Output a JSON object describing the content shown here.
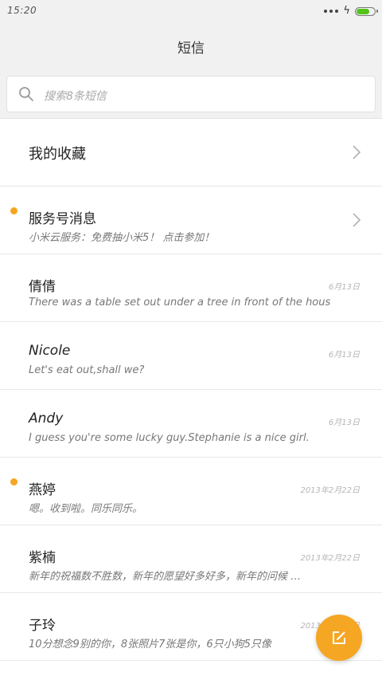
{
  "status_bar": {
    "time": "15:20",
    "battery_level": 0.78,
    "battery_color": "#53c41a",
    "icons": [
      "signal-dots-icon",
      "charging-bolt-icon",
      "battery-icon"
    ]
  },
  "header": {
    "title": "短信"
  },
  "search": {
    "placeholder": "搜索8条短信",
    "icon": "search-icon"
  },
  "favorites": {
    "label": "我的收藏",
    "icon": "chevron-right-icon"
  },
  "conversations": [
    {
      "sender": "服务号消息",
      "preview": "小米云服务：免费抽小米5！ 点击参加！",
      "date": "",
      "unread": true,
      "has_chevron": true
    },
    {
      "sender": "倩倩",
      "preview": "There was a table set out under a tree in front of the hous",
      "date": "6月13日",
      "unread": false,
      "has_chevron": false
    },
    {
      "sender": "Nicole",
      "preview": "Let's eat out,shall we?",
      "date": "6月13日",
      "unread": false,
      "has_chevron": false
    },
    {
      "sender": "Andy",
      "preview": "I guess you're some lucky guy.Stephanie is a nice girl.",
      "date": "6月13日",
      "unread": false,
      "has_chevron": false
    },
    {
      "sender": "燕婷",
      "preview": "嗯。收到啦。同乐同乐。",
      "date": "2013年2月22日",
      "unread": true,
      "has_chevron": false
    },
    {
      "sender": "紫楠",
      "preview": "新年的祝福数不胜数，新年的愿望好多好多，新年的问候 …",
      "date": "2013年2月22日",
      "unread": false,
      "has_chevron": false
    },
    {
      "sender": "子玲",
      "preview": "10分想念9别的你，8张照片7张是你，6只小狗5只像",
      "date": "2013年2月22日",
      "unread": false,
      "has_chevron": false
    }
  ],
  "fab": {
    "icon": "compose-icon",
    "color": "#f5a623"
  },
  "colors": {
    "accent": "#f5a623",
    "header_bg": "#f1f1f1"
  }
}
